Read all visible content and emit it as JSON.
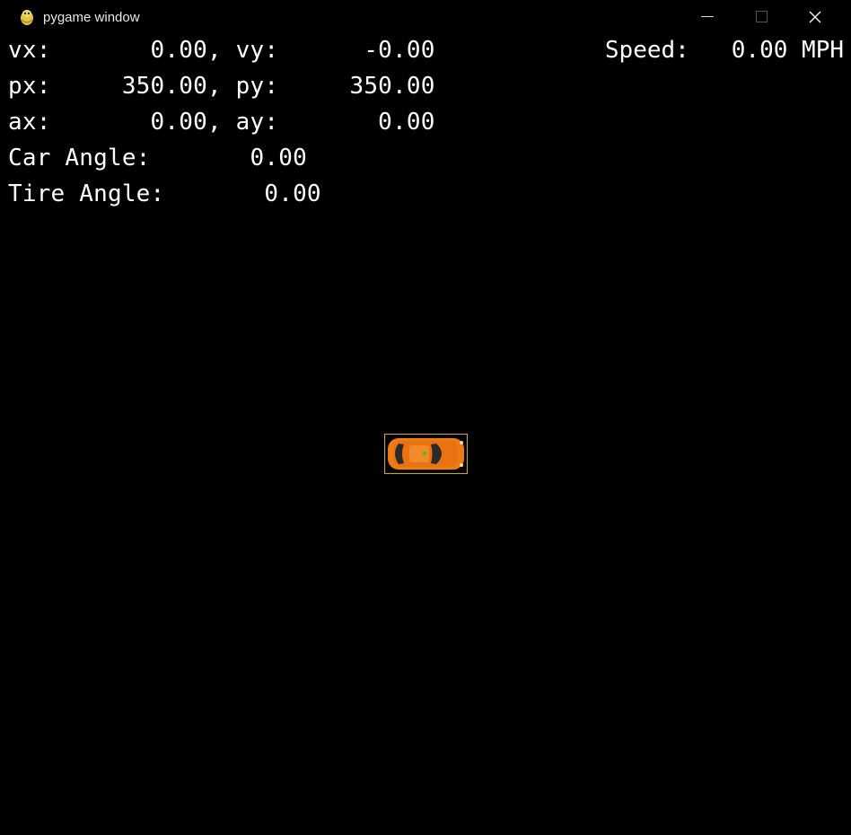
{
  "window": {
    "title": "pygame window",
    "app_icon": "pygame-snake-icon",
    "buttons": {
      "minimize": "minimize-icon",
      "maximize": "maximize-icon",
      "close": "close-icon"
    }
  },
  "hud": {
    "velocity": "vx:       0.00, vy:      -0.00",
    "position": "px:     350.00, py:     350.00",
    "acceleration": "ax:       0.00, ay:       0.00",
    "car_angle": "Car Angle:       0.00",
    "tire_angle": "Tire Angle:       0.00",
    "speed": "Speed:   0.00 MPH"
  },
  "car": {
    "body_color": "#f07a13",
    "outline_color": "#c8a24a",
    "window_color": "#2a2a2a",
    "marker_color": "#30c030"
  }
}
